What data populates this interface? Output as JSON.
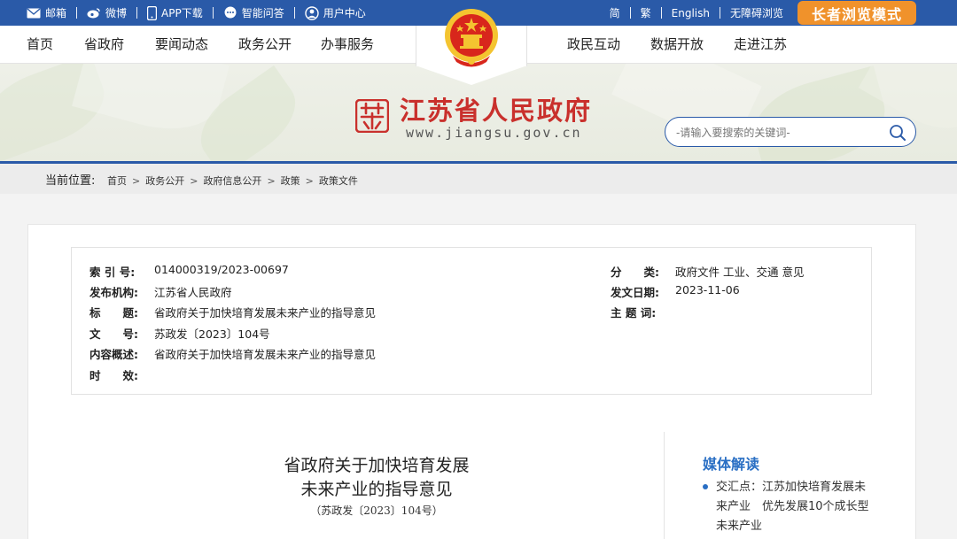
{
  "topbar": {
    "left_items": [
      {
        "label": "邮箱",
        "icon": "mail-icon"
      },
      {
        "label": "微博",
        "icon": "weibo-icon"
      },
      {
        "label": "APP下载",
        "icon": "phone-icon"
      },
      {
        "label": "智能问答",
        "icon": "chat-icon"
      },
      {
        "label": "用户中心",
        "icon": "user-icon"
      }
    ],
    "right_items": [
      "简",
      "繁",
      "English",
      "无障碍浏览"
    ],
    "elder_mode": "长者浏览模式",
    "color": "#2a5aa8"
  },
  "nav": {
    "left": [
      "首页",
      "省政府",
      "要闻动态",
      "政务公开",
      "办事服务"
    ],
    "right": [
      "政民互动",
      "数据开放",
      "走进江苏"
    ]
  },
  "banner": {
    "site_name": "江苏省人民政府",
    "site_url": "www.jiangsu.gov.cn",
    "search_placeholder": "-请输入要搜索的关键词-"
  },
  "breadcrumb": {
    "label": "当前位置:",
    "items": [
      "首页",
      "政务公开",
      "政府信息公开",
      "政策",
      "政策文件"
    ]
  },
  "meta": {
    "left": [
      {
        "label": "索 引 号:",
        "value": "014000319/2023-00697"
      },
      {
        "label": "发布机构:",
        "value": "江苏省人民政府"
      },
      {
        "label": "标　　题:",
        "value": "省政府关于加快培育发展未来产业的指导意见"
      },
      {
        "label": "文　　号:",
        "value": "苏政发〔2023〕104号"
      },
      {
        "label": "内容概述:",
        "value": "省政府关于加快培育发展未来产业的指导意见"
      },
      {
        "label": "时　　效:",
        "value": ""
      }
    ],
    "right": [
      {
        "label": "分　　类:",
        "value": "政府文件 工业、交通 意见"
      },
      {
        "label": "发文日期:",
        "value": "2023-11-06"
      },
      {
        "label": "主 题 词:",
        "value": ""
      }
    ]
  },
  "document": {
    "title_line1": "省政府关于加快培育发展",
    "title_line2": "未来产业的指导意见",
    "number": "（苏政发〔2023〕104号）"
  },
  "media": {
    "heading": "媒体解读",
    "items": [
      "交汇点：江苏加快培育发展未来产业　优先发展10个成长型未来产业"
    ]
  },
  "colors": {
    "brand_blue": "#2a5aa8",
    "brand_red": "#c9302c",
    "accent_orange": "#f0922b",
    "link_blue": "#2a6fc4"
  }
}
